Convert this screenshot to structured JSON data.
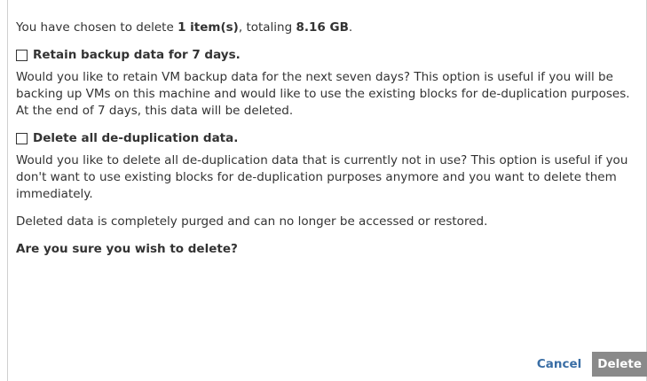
{
  "summary": {
    "prefix": "You have chosen to delete ",
    "count": "1 item(s)",
    "middle": ", totaling ",
    "size": "8.16 GB",
    "suffix": "."
  },
  "options": [
    {
      "label": "Retain backup data for 7 days.",
      "checked": false,
      "description": "Would you like to retain VM backup data for the next seven days? This option is useful if you will be backing up VMs on this machine and would like to use the existing blocks for de-duplication purposes. At the end of 7 days, this data will be deleted."
    },
    {
      "label": "Delete all de-duplication data.",
      "checked": false,
      "description": "Would you like to delete all de-duplication data that is currently not in use? This option is useful if you don't want to use existing blocks for de-duplication purposes anymore and you want to delete them immediately."
    }
  ],
  "purge_note": "Deleted data is completely purged and can no longer be accessed or restored.",
  "confirm_question": "Are you sure you wish to delete?",
  "buttons": {
    "cancel": "Cancel",
    "delete": "Delete"
  },
  "colors": {
    "link": "#3a6ea5",
    "delete_button_bg": "#8a8a8a",
    "text": "#333333"
  }
}
